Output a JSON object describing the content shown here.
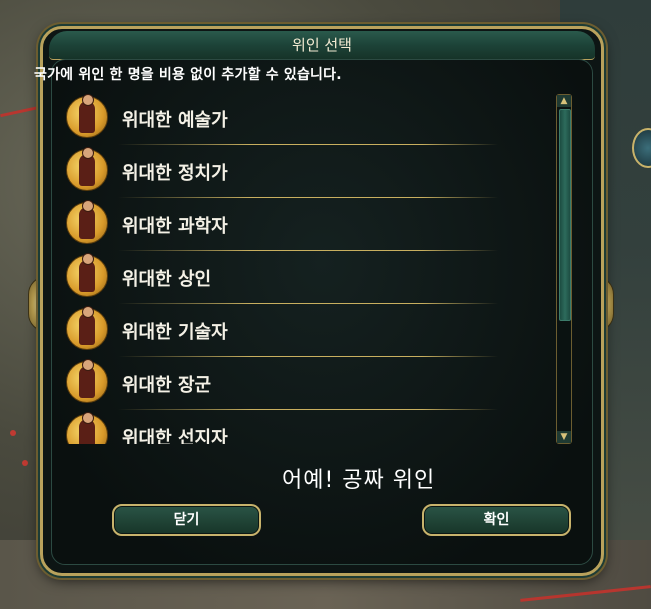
{
  "dialog": {
    "title": "위인 선택",
    "subtitle": "국가에 위인 한 명을 비용 없이 추가할 수 있습니다.",
    "caption": "어예! 공짜 위인",
    "buttons": {
      "close": "닫기",
      "confirm": "확인"
    }
  },
  "great_people": [
    {
      "label": "위대한 예술가",
      "icon": "great-artist-portrait"
    },
    {
      "label": "위대한 정치가",
      "icon": "great-statesman-portrait"
    },
    {
      "label": "위대한 과학자",
      "icon": "great-scientist-portrait"
    },
    {
      "label": "위대한 상인",
      "icon": "great-merchant-portrait"
    },
    {
      "label": "위대한 기술자",
      "icon": "great-engineer-portrait"
    },
    {
      "label": "위대한 장군",
      "icon": "great-general-portrait"
    },
    {
      "label": "위대한 선지자",
      "icon": "great-prophet-portrait"
    }
  ],
  "scrollbar": {
    "up": "▲",
    "down": "▼"
  },
  "colors": {
    "accent_gold": "#c8af5f",
    "panel_bg": "#0d1514",
    "title_green": "#1d4338",
    "map_border_red": "#b8362f"
  }
}
